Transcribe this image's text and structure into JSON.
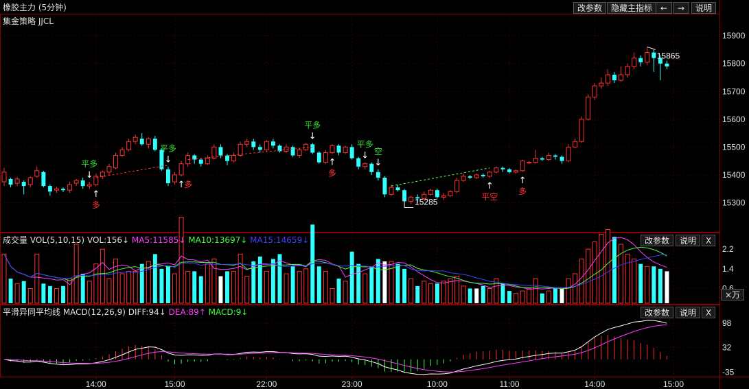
{
  "main": {
    "title": "橡胶主力 (5分钟)",
    "subtitle": "集金策略 JJCL",
    "buttons": [
      "改参数",
      "隐藏主指标",
      "←",
      "→",
      "说明"
    ],
    "y_ticks": [
      "15900",
      "15800",
      "15700",
      "15600",
      "15500",
      "15400",
      "15300"
    ],
    "high_label": "15865",
    "low_label": "15285"
  },
  "volume": {
    "title": "成交量 VOL(5,10,15)",
    "vol": "VOL:156↓",
    "ma5": "MA5:11585↓",
    "ma10": "MA10:13697↓",
    "ma15": "MA15:14659↓",
    "buttons": [
      "改参数",
      "说明",
      "X"
    ],
    "y_ticks": [
      "2.2",
      "1.4",
      "0.6"
    ],
    "unit": "×万"
  },
  "macd": {
    "title": "平滑异同平均线 MACD(12,26,9)",
    "diff": "DIFF:94↓",
    "dea": "DEA:89↑",
    "macd": "MACD:9↓",
    "buttons": [
      "改参数",
      "说明",
      "X"
    ],
    "y_ticks": [
      "98",
      "32",
      "-35"
    ]
  },
  "x_ticks": [
    "14:00",
    "15:00",
    "22:00",
    "23:00",
    "10:00",
    "11:00",
    "14:00",
    "15:00"
  ],
  "signals": [
    {
      "text": "平多",
      "color": "#33dd33",
      "arrow": "↓",
      "bar": 13,
      "dir": "above"
    },
    {
      "text": "多",
      "color": "#ff3333",
      "arrow": "↑",
      "bar": 14,
      "dir": "below"
    },
    {
      "text": "平多",
      "color": "#33dd33",
      "arrow": "↓",
      "bar": 25,
      "dir": "above"
    },
    {
      "text": "多",
      "color": "#ff3333",
      "arrow": "↑",
      "bar": 27,
      "dir": "below-right"
    },
    {
      "text": "平多",
      "color": "#33dd33",
      "arrow": "↓",
      "bar": 47,
      "dir": "above"
    },
    {
      "text": "多",
      "color": "#ff3333",
      "arrow": "↑",
      "bar": 50,
      "dir": "below"
    },
    {
      "text": "平多",
      "color": "#33dd33",
      "arrow": "↓",
      "bar": 55,
      "dir": "above"
    },
    {
      "text": "空",
      "color": "#33dd33",
      "arrow": "↓",
      "bar": 57,
      "dir": "above"
    },
    {
      "text": "平空",
      "color": "#ff3333",
      "arrow": "↑",
      "bar": 74,
      "dir": "below"
    },
    {
      "text": "多",
      "color": "#ff3333",
      "arrow": "↑",
      "bar": 79,
      "dir": "below"
    }
  ],
  "chart_data": {
    "type": "candlestick",
    "panels": [
      "price",
      "volume",
      "macd"
    ],
    "price_ylim": [
      15200,
      15930
    ],
    "volume_ylim": [
      0,
      2.4
    ],
    "macd_ylim": [
      -45,
      118
    ],
    "x_tick_bars": [
      14,
      26,
      40,
      53,
      66,
      77,
      90,
      102
    ],
    "candles": [
      [
        15375,
        15410,
        15425,
        15360,
        2.0
      ],
      [
        15385,
        15365,
        15390,
        15355,
        1.0
      ],
      [
        15370,
        15385,
        15392,
        15360,
        0.8
      ],
      [
        15375,
        15360,
        15380,
        15330,
        0.9
      ],
      [
        15365,
        15390,
        15395,
        15355,
        0.6
      ],
      [
        15395,
        15415,
        15430,
        15390,
        2.0
      ],
      [
        15410,
        15360,
        15415,
        15355,
        0.8
      ],
      [
        15360,
        15340,
        15365,
        15325,
        0.7
      ],
      [
        15345,
        15350,
        15358,
        15335,
        0.6
      ],
      [
        15350,
        15345,
        15355,
        15338,
        0.7
      ],
      [
        15345,
        15365,
        15375,
        15335,
        1.0
      ],
      [
        15370,
        15380,
        15385,
        15360,
        2.4
      ],
      [
        15380,
        15360,
        15390,
        15350,
        1.2
      ],
      [
        15360,
        15365,
        15375,
        15350,
        0.9
      ],
      [
        15365,
        15395,
        15405,
        15360,
        1.6
      ],
      [
        15395,
        15410,
        15415,
        15385,
        2.2
      ],
      [
        15410,
        15430,
        15440,
        15400,
        1.0
      ],
      [
        15425,
        15470,
        15480,
        15420,
        1.8
      ],
      [
        15470,
        15490,
        15500,
        15465,
        1.2
      ],
      [
        15490,
        15520,
        15530,
        15485,
        1.3
      ],
      [
        15520,
        15535,
        15545,
        15510,
        1.3
      ],
      [
        15530,
        15510,
        15550,
        15505,
        1.6
      ],
      [
        15510,
        15530,
        15535,
        15495,
        1.7
      ],
      [
        15530,
        15490,
        15540,
        15485,
        2.0
      ],
      [
        15490,
        15420,
        15495,
        15415,
        1.4
      ],
      [
        15420,
        15370,
        15430,
        15360,
        1.5
      ],
      [
        15375,
        15400,
        15410,
        15365,
        1.2
      ],
      [
        15400,
        15440,
        15450,
        15395,
        3.5
      ],
      [
        15440,
        15470,
        15480,
        15430,
        1.3
      ],
      [
        15470,
        15455,
        15475,
        15440,
        1.3
      ],
      [
        15455,
        15440,
        15460,
        15430,
        1.1
      ],
      [
        15440,
        15460,
        15470,
        15435,
        1.6
      ],
      [
        15460,
        15500,
        15510,
        15455,
        1.8
      ],
      [
        15500,
        15470,
        15510,
        15460,
        1.1
      ],
      [
        15470,
        15450,
        15475,
        15435,
        1.3
      ],
      [
        15450,
        15470,
        15480,
        15445,
        1.3
      ],
      [
        15470,
        15510,
        15520,
        15465,
        2.0
      ],
      [
        15510,
        15520,
        15530,
        15500,
        1.1
      ],
      [
        15520,
        15500,
        15530,
        15490,
        1.7
      ],
      [
        15500,
        15490,
        15510,
        15480,
        1.9
      ],
      [
        15490,
        15520,
        15525,
        15485,
        1.3
      ],
      [
        15520,
        15505,
        15530,
        15495,
        1.8
      ],
      [
        15505,
        15485,
        15510,
        15480,
        2.0
      ],
      [
        15485,
        15500,
        15510,
        15480,
        1.2
      ],
      [
        15500,
        15470,
        15505,
        15465,
        1.5
      ],
      [
        15470,
        15490,
        15495,
        15462,
        1.3
      ],
      [
        15490,
        15510,
        15515,
        15485,
        1.4
      ],
      [
        15510,
        15480,
        15515,
        15475,
        3.2
      ],
      [
        15480,
        15445,
        15485,
        15440,
        1.5
      ],
      [
        15445,
        15480,
        15490,
        15440,
        1.3
      ],
      [
        15480,
        15505,
        15510,
        15475,
        0.6
      ],
      [
        15505,
        15480,
        15510,
        15470,
        1.0
      ],
      [
        15480,
        15500,
        15505,
        15475,
        0.9
      ],
      [
        15500,
        15460,
        15510,
        15455,
        2.1
      ],
      [
        15460,
        15430,
        15465,
        15420,
        1.6
      ],
      [
        15430,
        15440,
        15445,
        15420,
        1.2
      ],
      [
        15440,
        15410,
        15445,
        15400,
        1.5
      ],
      [
        15410,
        15390,
        15420,
        15380,
        1.8
      ],
      [
        15390,
        15330,
        15395,
        15320,
        1.7
      ],
      [
        15330,
        15355,
        15365,
        15325,
        1.7
      ],
      [
        15355,
        15345,
        15365,
        15340,
        1.6
      ],
      [
        15345,
        15305,
        15350,
        15285,
        1.4
      ],
      [
        15305,
        15320,
        15325,
        15295,
        1.0
      ],
      [
        15320,
        15315,
        15330,
        15300,
        0.7
      ],
      [
        15315,
        15330,
        15340,
        15310,
        0.9
      ],
      [
        15330,
        15345,
        15350,
        15325,
        0.8
      ],
      [
        15345,
        15320,
        15350,
        15315,
        0.8
      ],
      [
        15320,
        15325,
        15335,
        15310,
        0.9
      ],
      [
        15325,
        15340,
        15345,
        15320,
        1.0
      ],
      [
        15340,
        15380,
        15390,
        15335,
        1.1
      ],
      [
        15380,
        15395,
        15405,
        15375,
        0.7
      ],
      [
        15395,
        15390,
        15400,
        15385,
        0.6
      ],
      [
        15390,
        15400,
        15405,
        15385,
        0.6
      ],
      [
        15400,
        15395,
        15405,
        15390,
        0.7
      ],
      [
        15395,
        15410,
        15415,
        15390,
        0.6
      ],
      [
        15410,
        15425,
        15430,
        15405,
        1.0
      ],
      [
        15425,
        15420,
        15430,
        15410,
        0.8
      ],
      [
        15420,
        15410,
        15425,
        15405,
        0.5
      ],
      [
        15410,
        15415,
        15420,
        15405,
        0.4
      ],
      [
        15415,
        15450,
        15455,
        15410,
        0.5
      ],
      [
        15445,
        15445,
        15450,
        15440,
        0.6
      ],
      [
        15445,
        15460,
        15490,
        15440,
        1.0
      ],
      [
        15460,
        15455,
        15465,
        15450,
        0.4
      ],
      [
        15455,
        15470,
        15480,
        15450,
        0.5
      ],
      [
        15470,
        15465,
        15475,
        15455,
        0.6
      ],
      [
        15465,
        15450,
        15470,
        15440,
        0.6
      ],
      [
        15450,
        15500,
        15510,
        15445,
        1.0
      ],
      [
        15500,
        15520,
        15530,
        15495,
        1.2
      ],
      [
        15520,
        15600,
        15610,
        15515,
        1.8
      ],
      [
        15600,
        15680,
        15690,
        15595,
        2.2
      ],
      [
        15680,
        15720,
        15730,
        15670,
        2.5
      ],
      [
        15720,
        15730,
        15750,
        15710,
        2.8
      ],
      [
        15730,
        15760,
        15780,
        15720,
        3.0
      ],
      [
        15760,
        15740,
        15770,
        15730,
        2.7
      ],
      [
        15740,
        15760,
        15790,
        15735,
        2.4
      ],
      [
        15760,
        15790,
        15800,
        15750,
        2.0
      ],
      [
        15790,
        15820,
        15840,
        15780,
        1.8
      ],
      [
        15820,
        15805,
        15830,
        15790,
        1.6
      ],
      [
        15805,
        15840,
        15860,
        15795,
        1.5
      ],
      [
        15840,
        15820,
        15850,
        15770,
        1.5
      ],
      [
        15820,
        15800,
        15830,
        15740,
        1.4
      ],
      [
        15800,
        15790,
        15810,
        15780,
        1.3
      ]
    ],
    "white_volume_bars": [
      33,
      58,
      72,
      85,
      101
    ],
    "high": 15865,
    "low": 15285
  }
}
